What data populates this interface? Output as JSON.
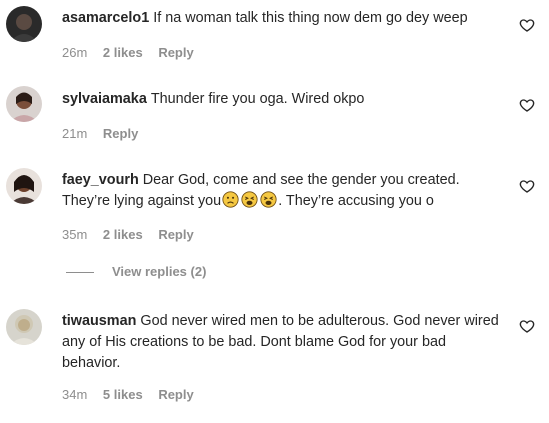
{
  "comments": [
    {
      "username": "asamarcelo1",
      "text": "If na woman talk this thing now dem go dey weep",
      "time": "26m",
      "likes": "2 likes",
      "reply": "Reply"
    },
    {
      "username": "sylvaiamaka",
      "text": "Thunder fire you oga. Wired okpo",
      "time": "21m",
      "reply": "Reply"
    },
    {
      "username": "faey_vourh",
      "text_before": "Dear God, come and see the gender you created. They’re lying against you",
      "text_after": ". They’re accusing you o",
      "time": "35m",
      "likes": "2 likes",
      "reply": "Reply",
      "view_replies": "View replies (2)"
    },
    {
      "username": "tiwausman",
      "text": "God never wired men to be adulterous. God never wired any of His creations to be bad. Dont blame God for your bad behavior.",
      "time": "34m",
      "likes": "5 likes",
      "reply": "Reply"
    }
  ],
  "colors": {
    "text": "#262626",
    "meta": "#8e8e8e",
    "emoji": "#f5c842"
  },
  "icons": {
    "like": "heart-outline-icon",
    "emoji_1": "frowning-face-emoji",
    "emoji_2": "weary-face-emoji",
    "emoji_3": "weary-face-emoji"
  }
}
